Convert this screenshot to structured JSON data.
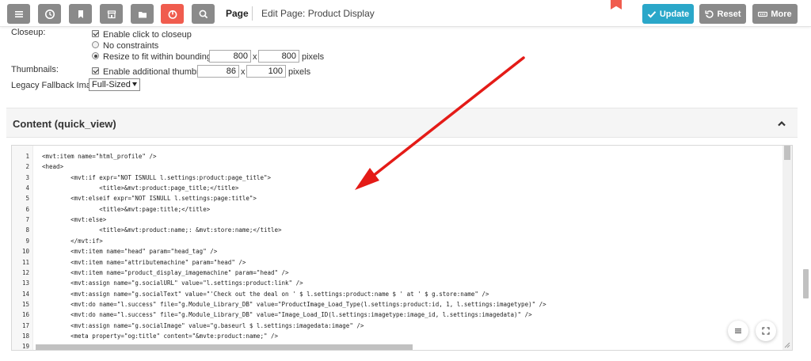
{
  "toolbar": {
    "title": "Page",
    "subtitle": "Edit Page: Product Display",
    "update_label": "Update",
    "reset_label": "Reset",
    "more_label": "More",
    "accent": "#2aa7c9",
    "alert_color": "#f05c4e"
  },
  "settings": {
    "closeup_label": "Closeup:",
    "enable_closeup_label": "Enable click to closeup",
    "no_constraints_label": "No constraints",
    "resize_label": "Resize to fit within bounding box:",
    "resize_width": "800",
    "resize_height": "800",
    "x_sep": "x",
    "pixels_label": "pixels",
    "thumbnails_label": "Thumbnails:",
    "enable_thumbs_label": "Enable additional thumbnails:",
    "thumb_width": "86",
    "thumb_height": "100",
    "legacy_label": "Legacy Fallback Image:",
    "legacy_value": "Full-Sized"
  },
  "section": {
    "title": "Content (quick_view)"
  },
  "editor": {
    "lines": [
      {
        "n": "1",
        "text": "<mvt:item name=\"html_profile\" />"
      },
      {
        "n": "2",
        "text": "<head>"
      },
      {
        "n": "3",
        "text": "        <mvt:if expr=\"NOT ISNULL l.settings:product:page_title\">"
      },
      {
        "n": "4",
        "text": "                <title>&mvt:product:page_title;</title>"
      },
      {
        "n": "5",
        "text": "        <mvt:elseif expr=\"NOT ISNULL l.settings:page:title\">"
      },
      {
        "n": "6",
        "text": "                <title>&mvt:page:title;</title>"
      },
      {
        "n": "7",
        "text": "        <mvt:else>"
      },
      {
        "n": "8",
        "text": "                <title>&mvt:product:name;: &mvt:store:name;</title>"
      },
      {
        "n": "9",
        "text": "        </mvt:if>"
      },
      {
        "n": "10",
        "text": "        <mvt:item name=\"head\" param=\"head_tag\" />"
      },
      {
        "n": "11",
        "text": "        <mvt:item name=\"attributemachine\" param=\"head\" />"
      },
      {
        "n": "12",
        "text": "        <mvt:item name=\"product_display_imagemachine\" param=\"head\" />"
      },
      {
        "n": "13",
        "text": "        <mvt:assign name=\"g.socialURL\" value=\"l.settings:product:link\" />"
      },
      {
        "n": "14",
        "text": "        <mvt:assign name=\"g.socialText\" value=\"'Check out the deal on ' $ l.settings:product:name $ ' at ' $ g.store:name\" />"
      },
      {
        "n": "15",
        "text": "        <mvt:do name=\"l.success\" file=\"g.Module_Library_DB\" value=\"ProductImage_Load_Type(l.settings:product:id, 1, l.settings:imagetype)\" />"
      },
      {
        "n": "16",
        "text": "        <mvt:do name=\"l.success\" file=\"g.Module_Library_DB\" value=\"Image_Load_ID(l.settings:imagetype:image_id, l.settings:imagedata)\" />"
      },
      {
        "n": "17",
        "text": "        <mvt:assign name=\"g.socialImage\" value=\"g.baseurl $ l.settings:imagedata:image\" />"
      },
      {
        "n": "18",
        "text": "        <meta property=\"og:title\" content=\"&mvte:product:name;\" />"
      },
      {
        "n": "19",
        "text": ""
      }
    ]
  },
  "icons": {
    "menu": "hamburger-icon",
    "history": "clock-icon",
    "bookmark": "bookmark-icon",
    "store": "storefront-icon",
    "folder": "folder-icon",
    "alert": "power-icon",
    "search": "search-icon"
  }
}
